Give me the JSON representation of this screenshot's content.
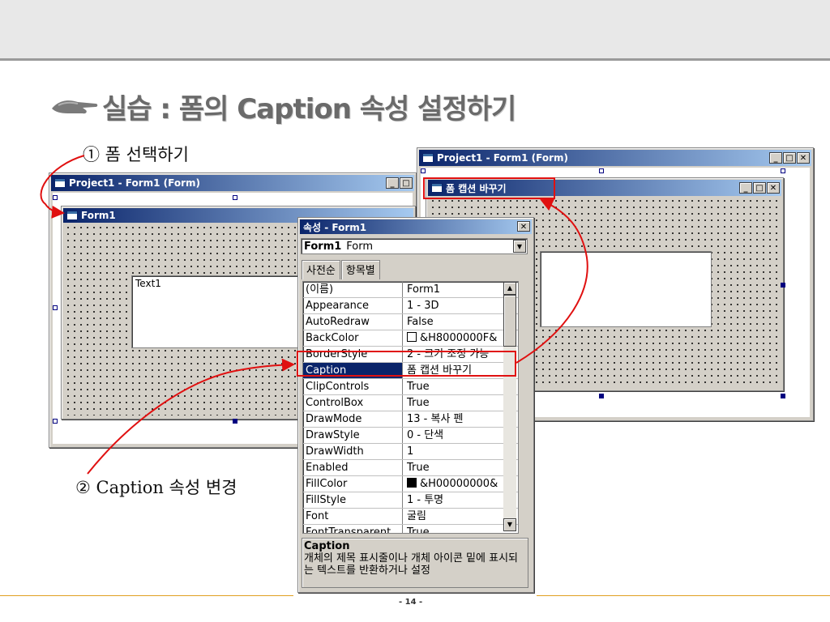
{
  "slide": {
    "title": "실습 : 폼의 Caption 속성 설정하기",
    "step1": "① 폼 선택하기",
    "step2": "② Caption 속성 변경",
    "page_number": "- 14 -"
  },
  "left_project_window": {
    "title": "Project1 - Form1 (Form)",
    "form_title": "Form1",
    "textbox_text": "Text1"
  },
  "right_project_window": {
    "title": "Project1 - Form1 (Form)",
    "form_title": "폼 캡션 바꾸기"
  },
  "properties_window": {
    "title": "속성 - Form1",
    "object_name": "Form1",
    "object_type": "Form",
    "tabs": [
      "사전순",
      "항목별"
    ],
    "rows": [
      {
        "name": "(이름)",
        "value": "Form1"
      },
      {
        "name": "Appearance",
        "value": "1 - 3D"
      },
      {
        "name": "AutoRedraw",
        "value": "False"
      },
      {
        "name": "BackColor",
        "value": "&H8000000F&"
      },
      {
        "name": "BorderStyle",
        "value": "2 - 크기 조정 가능"
      },
      {
        "name": "Caption",
        "value": "폼 캡션 바꾸기"
      },
      {
        "name": "ClipControls",
        "value": "True"
      },
      {
        "name": "ControlBox",
        "value": "True"
      },
      {
        "name": "DrawMode",
        "value": "13 - 복사 펜"
      },
      {
        "name": "DrawStyle",
        "value": "0 - 단색"
      },
      {
        "name": "DrawWidth",
        "value": "1"
      },
      {
        "name": "Enabled",
        "value": "True"
      },
      {
        "name": "FillColor",
        "value": "&H00000000&"
      },
      {
        "name": "FillStyle",
        "value": "1 - 투명"
      },
      {
        "name": "Font",
        "value": "굴림"
      },
      {
        "name": "FontTransparent",
        "value": "True"
      }
    ],
    "description_title": "Caption",
    "description_text": "개체의 제목 표시줄이나 개체 아이콘 밑에 표시되는 텍스트를 반환하거나 설정"
  },
  "colors": {
    "title_bar": "#0a246a",
    "highlight": "#e01010",
    "footer_line": "#e0a020",
    "backcolor_swatch": "#ffffff",
    "fillcolor_swatch": "#000000"
  }
}
